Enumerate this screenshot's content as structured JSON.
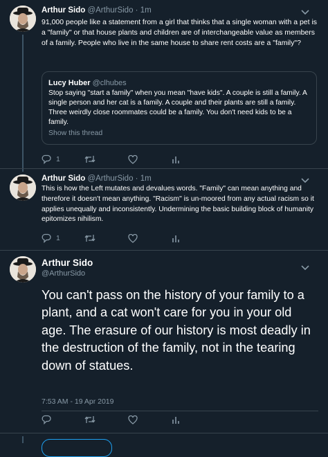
{
  "tweet1": {
    "name": "Arthur Sido",
    "handle": "@ArthurSido",
    "separator": "·",
    "time": "1m",
    "text": "91,000 people like a statement from a girl that thinks that a single woman with a pet is a \"family\" or that house plants and children are of interchangeable value as members of a family. People who live in the same house to share rent costs are a \"family\"?",
    "quote": {
      "name": "Lucy Huber",
      "handle": "@clhubes",
      "text": "Stop saying \"start a family\" when you mean \"have kids\". A couple is still a family. A single person and her cat is a family. A couple and their plants are still a family. Three weirdly close roommates could be a family. You don't need kids to be a family.",
      "link": "Show this thread"
    },
    "reply_count": "1",
    "retweet_count": "",
    "like_count": ""
  },
  "tweet2": {
    "name": "Arthur Sido",
    "handle": "@ArthurSido",
    "separator": "·",
    "time": "1m",
    "text": "This is how the Left mutates and devalues words. \"Family\" can mean anything and therefore it doesn't mean anything. \"Racism\" is un-moored from any actual racism so it applies unequally and inconsistently. Undermining the basic building block of humanity epitomizes nihilism.",
    "reply_count": "1"
  },
  "tweet3": {
    "name": "Arthur Sido",
    "handle": "@ArthurSido",
    "text": "You can't pass on the history of your family to a plant, and a cat won't care for you in your old age. The erasure of our history is most deadly in the destruction of the family, not in the tearing down of statues.",
    "timestamp": "7:53 AM - 19 Apr 2019"
  },
  "icons": {
    "reply": "reply-icon",
    "retweet": "retweet-icon",
    "like": "heart-icon",
    "analytics": "analytics-icon",
    "more": "chevron-down-icon"
  },
  "colors": {
    "background": "#15202b",
    "border": "#38444d",
    "secondary_text": "#8899a6",
    "accent": "#1da1f2"
  }
}
